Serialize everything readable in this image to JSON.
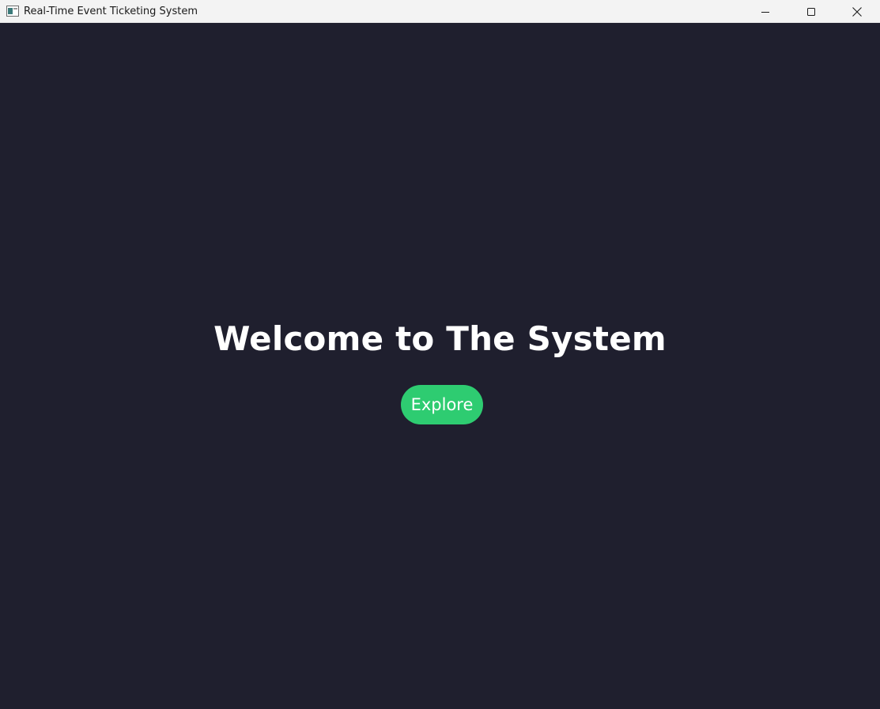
{
  "window": {
    "title": "Real-Time Event Ticketing System",
    "controls": {
      "minimize": "minimize-icon",
      "maximize": "maximize-icon",
      "close": "close-icon"
    }
  },
  "main": {
    "heading": "Welcome to The System",
    "explore_label": "Explore"
  },
  "colors": {
    "background": "#1f1f2e",
    "accent": "#2ecc71",
    "text": "#ffffff",
    "titlebar": "#f3f3f3"
  }
}
